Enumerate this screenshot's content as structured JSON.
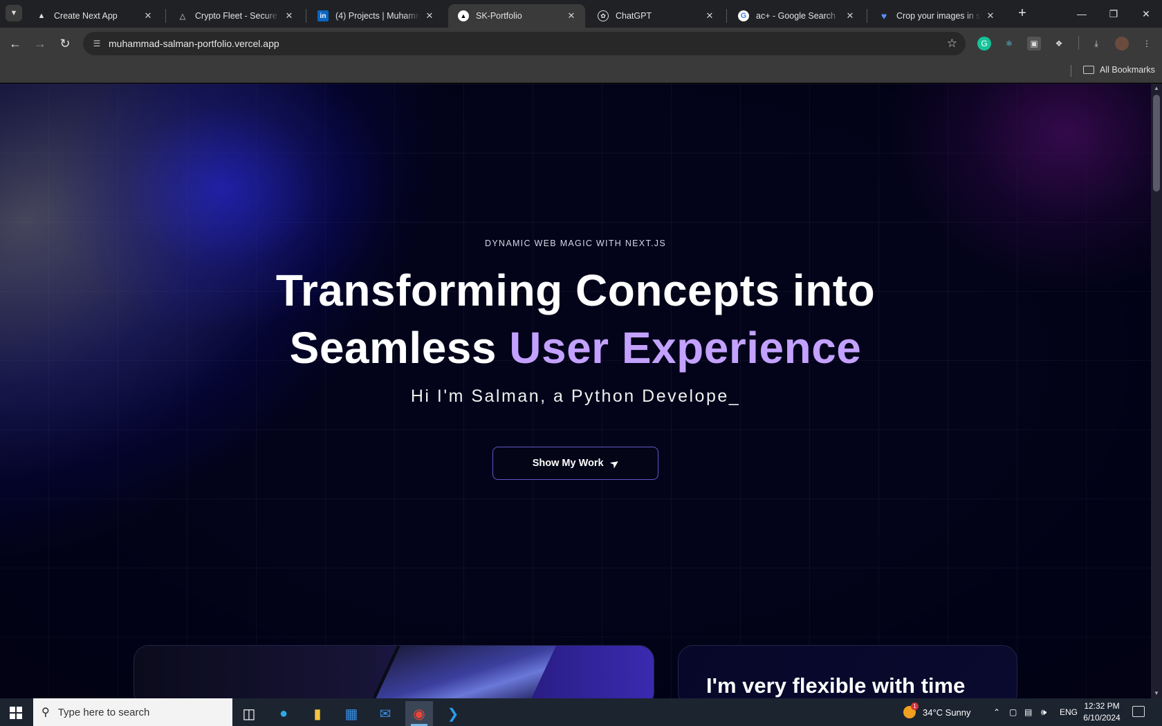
{
  "browser": {
    "tabs": [
      {
        "title": "Create Next App",
        "favicon": "vercel-triangle-icon",
        "active": false
      },
      {
        "title": "Crypto Fleet - Secure and",
        "favicon": "drive-icon",
        "active": false
      },
      {
        "title": "(4) Projects | Muhammad",
        "favicon": "linkedin-icon",
        "active": false
      },
      {
        "title": "SK-Portfolio",
        "favicon": "vercel-triangle-icon",
        "active": true
      },
      {
        "title": "ChatGPT",
        "favicon": "chatgpt-icon",
        "active": false
      },
      {
        "title": "ac+ - Google Search",
        "favicon": "google-icon",
        "active": false
      },
      {
        "title": "Crop your images in seco",
        "favicon": "heart-gem-icon",
        "active": false
      }
    ],
    "url": "muhammad-salman-portfolio.vercel.app",
    "bookmarks_label": "All Bookmarks",
    "linkedin_glyph": "in"
  },
  "page": {
    "eyebrow": "DYNAMIC WEB MAGIC WITH NEXT.JS",
    "headline_line1": "Transforming Concepts into",
    "headline_line2_plain": "Seamless ",
    "headline_line2_accent": "User Experience",
    "typing_text": "Hi I'm Salman, a Python Develope_",
    "cta_label": "Show My Work",
    "card_right_title": "I'm very flexible with time",
    "colors": {
      "accent": "#c3a1ff",
      "background": "#03031a",
      "button_border": "#6157c9"
    }
  },
  "taskbar": {
    "search_placeholder": "Type here to search",
    "weather_badge": "1",
    "weather": "34°C  Sunny",
    "language": "ENG",
    "time": "12:32 PM",
    "date": "6/10/2024"
  }
}
